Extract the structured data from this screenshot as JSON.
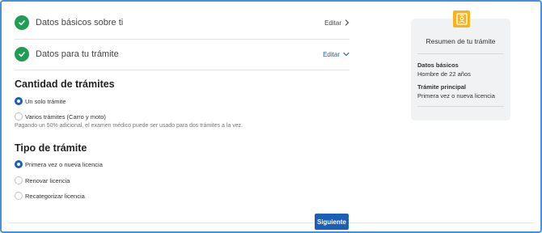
{
  "steps": [
    {
      "title": "Datos básicos sobre ti",
      "edit_label": "Editar"
    },
    {
      "title": "Datos para tu trámite",
      "edit_label": "Editar"
    }
  ],
  "quantity": {
    "title": "Cantidad de trámites",
    "options": [
      {
        "label": "Un solo trámite",
        "selected": true
      },
      {
        "label": "Varios trámites (Carro y moto)",
        "selected": false
      }
    ],
    "hint": "Pagando un 50% adicional, el examen médico puede ser usado para dos trámites a la vez."
  },
  "procedure_type": {
    "title": "Tipo de trámite",
    "options": [
      {
        "label": "Primera vez o nueva licencia",
        "selected": true
      },
      {
        "label": "Renovar licencia",
        "selected": false
      },
      {
        "label": "Recategorizar licencia",
        "selected": false
      }
    ]
  },
  "summary": {
    "title": "Resumen de tu trámite",
    "basic_label": "Datos básicos",
    "basic_value": "Hombre de 22 años",
    "main_label": "Trámite principal",
    "main_value": "Primera vez o nueva licencia"
  },
  "next_button": "Siguiente",
  "colors": {
    "accent": "#1c5fb8",
    "success": "#1f9d55",
    "badge": "#f5b31c"
  },
  "icons": {
    "check": "check-icon",
    "chevron_right": "chevron-right-icon",
    "chevron_down": "chevron-down-icon",
    "badge": "id-badge-icon"
  }
}
